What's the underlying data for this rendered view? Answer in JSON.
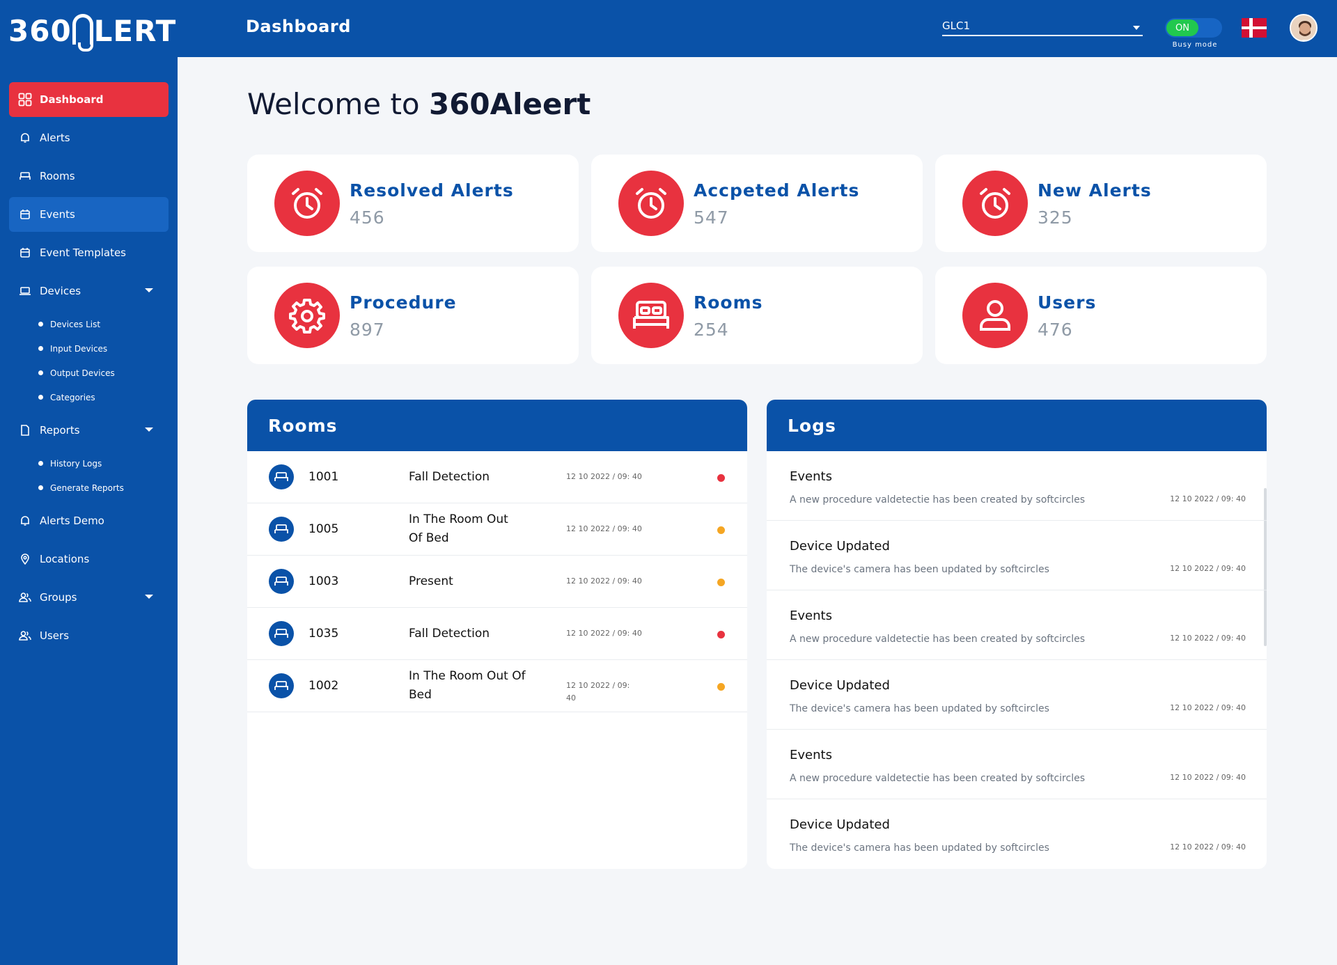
{
  "brand": {
    "name": "360ALERT",
    "prefix": "360",
    "suffix": "LERT"
  },
  "topbar": {
    "title": "Dashboard",
    "location_select": "GLC1",
    "toggle_label": "ON",
    "busy_mode_label": "Busy mode"
  },
  "sidebar": {
    "items": [
      {
        "label": "Dashboard",
        "icon": "grid-icon"
      },
      {
        "label": "Alerts",
        "icon": "bell-icon"
      },
      {
        "label": "Rooms",
        "icon": "bed-icon"
      },
      {
        "label": "Events",
        "icon": "calendar-icon"
      },
      {
        "label": "Event Templates",
        "icon": "calendar-icon"
      },
      {
        "label": "Devices",
        "icon": "laptop-icon"
      },
      {
        "label": "Reports",
        "icon": "document-icon"
      },
      {
        "label": "Alerts Demo",
        "icon": "bell-icon"
      },
      {
        "label": "Locations",
        "icon": "location-pin-icon"
      },
      {
        "label": "Groups",
        "icon": "group-icon"
      },
      {
        "label": "Users",
        "icon": "group-icon"
      }
    ],
    "devices_sub": [
      "Devices List",
      "Input Devices",
      "Output Devices",
      "Categories"
    ],
    "reports_sub": [
      "History Logs",
      "Generate Reports"
    ]
  },
  "welcome": {
    "prefix": "Welcome to ",
    "name": "360Aleert"
  },
  "stats": [
    {
      "label": "Resolved Alerts",
      "value": "456",
      "icon": "alarm-clock-icon"
    },
    {
      "label": "Accpeted Alerts",
      "value": "547",
      "icon": "alarm-clock-icon"
    },
    {
      "label": "New Alerts",
      "value": "325",
      "icon": "alarm-clock-icon"
    },
    {
      "label": "Procedure",
      "value": "897",
      "icon": "gear-icon"
    },
    {
      "label": "Rooms",
      "value": "254",
      "icon": "bed-icon"
    },
    {
      "label": "Users",
      "value": "476",
      "icon": "user-icon"
    }
  ],
  "rooms_panel": {
    "title": "Rooms",
    "rows": [
      {
        "room": "1001",
        "type": "Fall Detection",
        "date": "12 10 2022 / 09: 40",
        "status_color": "#e8323f"
      },
      {
        "room": "1005",
        "type": "In The Room Out Of Bed",
        "date": "12 10 2022 / 09: 40",
        "status_color": "#f5a623"
      },
      {
        "room": "1003",
        "type": "Present",
        "date": "12 10 2022 / 09: 40",
        "status_color": "#f5a623"
      },
      {
        "room": "1035",
        "type": "Fall Detection",
        "date": "12 10 2022 / 09: 40",
        "status_color": "#e8323f"
      },
      {
        "room": "1002",
        "type": "In The Room Out Of Bed",
        "date": "12 10 2022 / 09: 40",
        "status_color": "#f5a623"
      }
    ]
  },
  "logs_panel": {
    "title": "Logs",
    "rows": [
      {
        "title": "Events",
        "desc": "A new procedure valdetectie has been created by softcircles",
        "date": "12 10 2022 / 09: 40"
      },
      {
        "title": "Device Updated",
        "desc": "The device's camera has been updated by softcircles",
        "date": "12 10 2022 / 09: 40"
      },
      {
        "title": "Events",
        "desc": "A new procedure valdetectie has been created by softcircles",
        "date": "12 10 2022 / 09: 40"
      },
      {
        "title": "Device Updated",
        "desc": "The device's camera has been updated by softcircles",
        "date": "12 10 2022 / 09: 40"
      },
      {
        "title": "Events",
        "desc": "A new procedure valdetectie has been created by softcircles",
        "date": "12 10 2022 / 09: 40"
      },
      {
        "title": "Device Updated",
        "desc": "The device's camera has been updated by softcircles",
        "date": "12 10 2022 / 09: 40"
      }
    ]
  },
  "colors": {
    "brand_blue": "#0a52a8",
    "accent_red": "#e8323f",
    "warning_orange": "#f5a623",
    "toggle_green": "#21c84e"
  }
}
